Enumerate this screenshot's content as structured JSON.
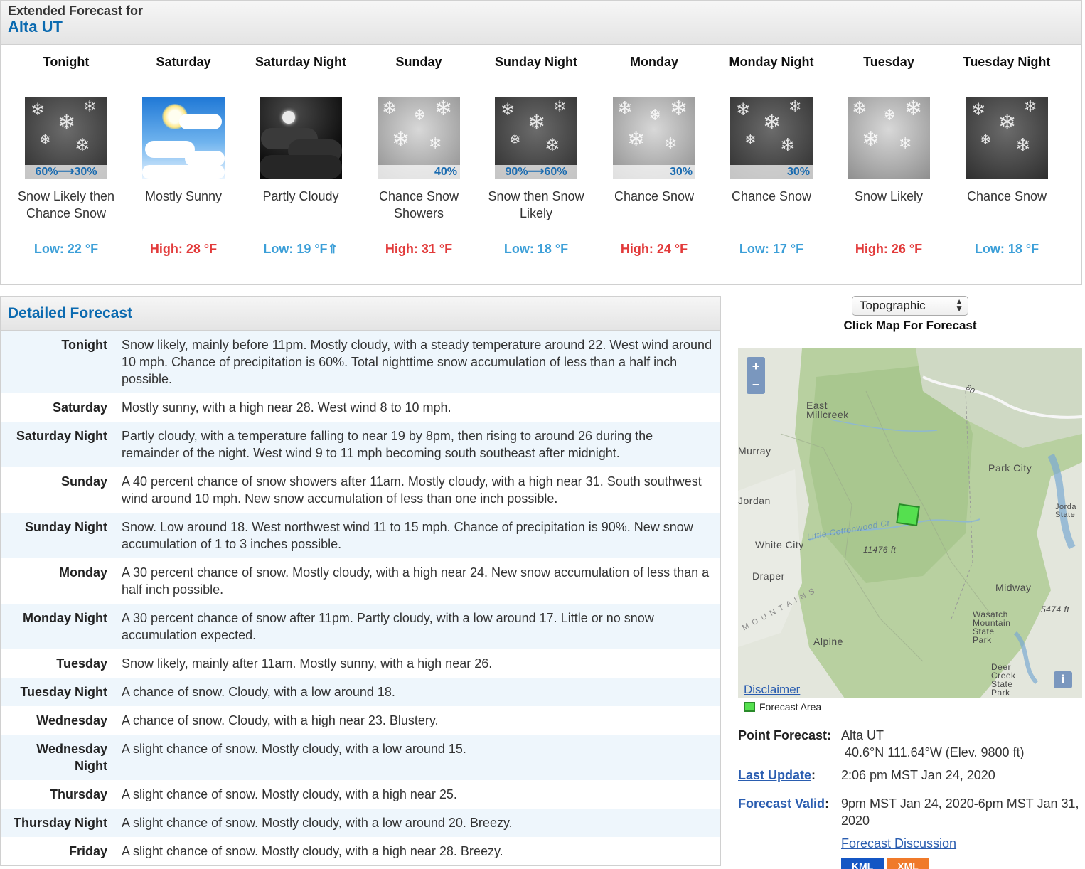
{
  "extended": {
    "title_line1": "Extended Forecast for",
    "title_line2": "Alta UT"
  },
  "periods": [
    {
      "name": "Tonight",
      "desc": "Snow Likely then Chance Snow",
      "pop": "60%⟶30%",
      "temp": "Low: 22 °F",
      "kind": "low",
      "icon": "snow-dark-icon"
    },
    {
      "name": "Saturday",
      "desc": "Mostly Sunny",
      "pop": "",
      "temp": "High: 28 °F",
      "kind": "high",
      "icon": "sunny-icon"
    },
    {
      "name": "Saturday Night",
      "desc": "Partly Cloudy",
      "pop": "",
      "temp": "Low: 19 °F⇑",
      "kind": "low",
      "icon": "night-cloudy-icon"
    },
    {
      "name": "Sunday",
      "desc": "Chance Snow Showers",
      "pop": "40%",
      "temp": "High: 31 °F",
      "kind": "high",
      "icon": "snow-light-icon"
    },
    {
      "name": "Sunday Night",
      "desc": "Snow then Snow Likely",
      "pop": "90%⟶60%",
      "temp": "Low: 18 °F",
      "kind": "low",
      "icon": "snow-dark-icon"
    },
    {
      "name": "Monday",
      "desc": "Chance Snow",
      "pop": "30%",
      "temp": "High: 24 °F",
      "kind": "high",
      "icon": "snow-light-icon"
    },
    {
      "name": "Monday Night",
      "desc": "Chance Snow",
      "pop": "30%",
      "temp": "Low: 17 °F",
      "kind": "low",
      "icon": "snow-dark-icon"
    },
    {
      "name": "Tuesday",
      "desc": "Snow Likely",
      "pop": "",
      "temp": "High: 26 °F",
      "kind": "high",
      "icon": "snow-light-icon"
    },
    {
      "name": "Tuesday Night",
      "desc": "Chance Snow",
      "pop": "",
      "temp": "Low: 18 °F",
      "kind": "low",
      "icon": "snow-dark-icon"
    }
  ],
  "detailed": {
    "title": "Detailed Forecast",
    "rows": [
      {
        "label": "Tonight",
        "text": "Snow likely, mainly before 11pm. Mostly cloudy, with a steady temperature around 22. West wind around 10 mph. Chance of precipitation is 60%. Total nighttime snow accumulation of less than a half inch possible."
      },
      {
        "label": "Saturday",
        "text": "Mostly sunny, with a high near 28. West wind 8 to 10 mph."
      },
      {
        "label": "Saturday Night",
        "text": "Partly cloudy, with a temperature falling to near 19 by 8pm, then rising to around 26 during the remainder of the night. West wind 9 to 11 mph becoming south southeast after midnight."
      },
      {
        "label": "Sunday",
        "text": "A 40 percent chance of snow showers after 11am. Mostly cloudy, with a high near 31. South southwest wind around 10 mph. New snow accumulation of less than one inch possible."
      },
      {
        "label": "Sunday Night",
        "text": "Snow. Low around 18. West northwest wind 11 to 15 mph. Chance of precipitation is 90%. New snow accumulation of 1 to 3 inches possible."
      },
      {
        "label": "Monday",
        "text": "A 30 percent chance of snow. Mostly cloudy, with a high near 24. New snow accumulation of less than a half inch possible."
      },
      {
        "label": "Monday Night",
        "text": "A 30 percent chance of snow after 11pm. Partly cloudy, with a low around 17. Little or no snow accumulation expected."
      },
      {
        "label": "Tuesday",
        "text": "Snow likely, mainly after 11am. Mostly sunny, with a high near 26."
      },
      {
        "label": "Tuesday Night",
        "text": "A chance of snow. Cloudy, with a low around 18."
      },
      {
        "label": "Wednesday",
        "text": "A chance of snow. Cloudy, with a high near 23. Blustery."
      },
      {
        "label": "Wednesday Night",
        "text": "A slight chance of snow. Mostly cloudy, with a low around 15."
      },
      {
        "label": "Thursday",
        "text": "A slight chance of snow. Mostly cloudy, with a high near 25."
      },
      {
        "label": "Thursday Night",
        "text": "A slight chance of snow. Mostly cloudy, with a low around 20. Breezy."
      },
      {
        "label": "Friday",
        "text": "A slight chance of snow. Mostly cloudy, with a high near 28. Breezy."
      }
    ]
  },
  "map": {
    "select_value": "Topographic",
    "click_label": "Click Map For Forecast",
    "zoom_in": "+",
    "zoom_out": "−",
    "info": "i",
    "disclaimer": "Disclaimer",
    "legend": "Forecast Area",
    "labels": {
      "east_millcreek": "East Millcreek",
      "murray": "Murray",
      "jordan": "Jordan",
      "white_city": "White City",
      "draper": "Draper",
      "alpine": "Alpine",
      "park_city": "Park City",
      "midway": "Midway",
      "wasatch": "Wasatch Mountain State Park",
      "deer_creek": "Deer Creek State Park",
      "elev1": "11476 ft",
      "elev2": "5474 ft",
      "little_cottonwood": "Little Cottonwood Cr",
      "mountains": "MOUNTAINS",
      "route": "80",
      "jordanelle": "Jorda State"
    }
  },
  "point": {
    "label": "Point Forecast:",
    "place": "Alta UT",
    "coords": "40.6°N 111.64°W (Elev. 9800 ft)",
    "last_update_label": "Last Update",
    "last_update": "2:06 pm MST Jan 24, 2020",
    "valid_label": "Forecast Valid",
    "valid": "9pm MST Jan 24, 2020-6pm MST Jan 31, 2020",
    "discussion": "Forecast Discussion",
    "kml": "KML",
    "xml": "XML",
    "colon": ":"
  },
  "colors": {
    "brand_blue": "#0b6ab0",
    "low_temp": "#3c9fd8",
    "high_temp": "#e23a3a",
    "link": "#2a5db0",
    "kml": "#1456c4",
    "xml": "#f07a2a",
    "forecast_area": "#55e04f"
  }
}
